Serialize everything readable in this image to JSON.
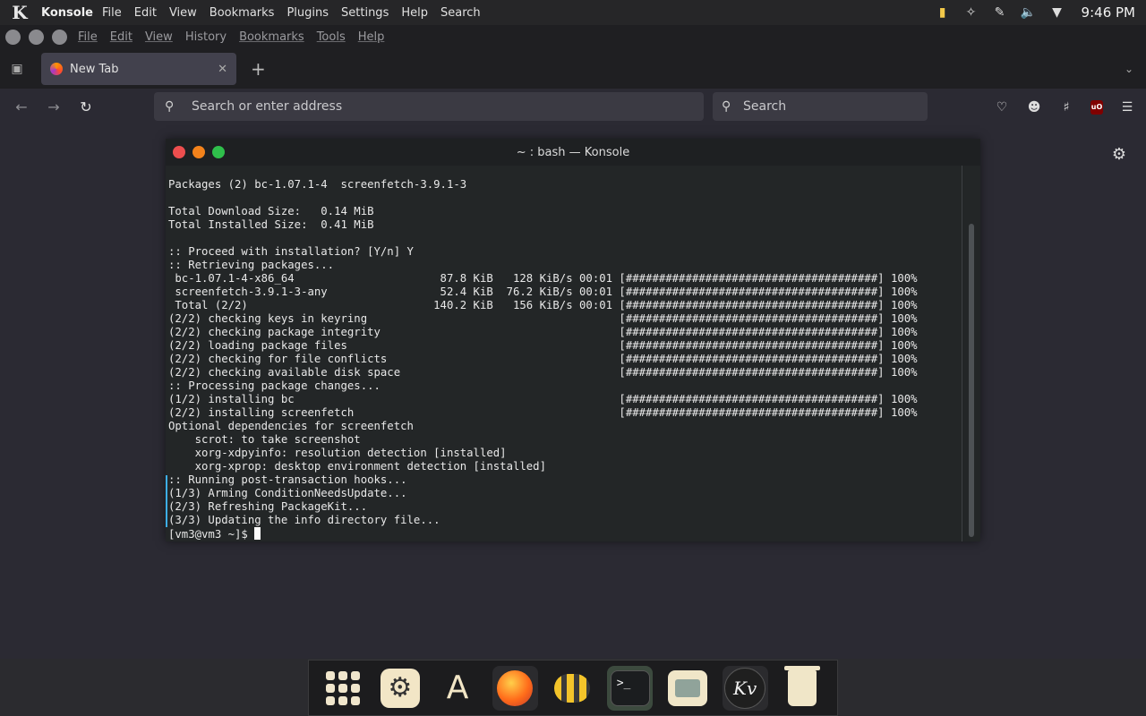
{
  "top_panel": {
    "app_name": "Konsole",
    "global_menu": [
      "File",
      "Edit",
      "View",
      "Bookmarks",
      "Plugins",
      "Settings",
      "Help",
      "Search"
    ],
    "clock": "9:46 PM",
    "tray_icons": [
      "package-updates-icon",
      "network-icon",
      "pen-icon",
      "volume-muted-icon",
      "chevron-down-icon"
    ]
  },
  "firefox": {
    "menubar": [
      "File",
      "Edit",
      "View",
      "History",
      "Bookmarks",
      "Tools",
      "Help"
    ],
    "tab": {
      "title": "New Tab"
    },
    "urlbar": {
      "placeholder": "Search or enter address"
    },
    "searchbar": {
      "placeholder": "Search"
    },
    "colors": {
      "toolbar": "#2b2a33",
      "tab_active": "#42414d",
      "field": "#3b3a43"
    }
  },
  "konsole": {
    "title": "~ : bash — Konsole",
    "lines": [
      "Packages (2) bc-1.07.1-4  screenfetch-3.9.1-3",
      "",
      "Total Download Size:   0.14 MiB",
      "Total Installed Size:  0.41 MiB",
      "",
      ":: Proceed with installation? [Y/n] Y",
      ":: Retrieving packages...",
      " bc-1.07.1-4-x86_64                      87.8 KiB   128 KiB/s 00:01 [######################################] 100%",
      " screenfetch-3.9.1-3-any                 52.4 KiB  76.2 KiB/s 00:01 [######################################] 100%",
      " Total (2/2)                            140.2 KiB   156 KiB/s 00:01 [######################################] 100%",
      "(2/2) checking keys in keyring                                      [######################################] 100%",
      "(2/2) checking package integrity                                    [######################################] 100%",
      "(2/2) loading package files                                         [######################################] 100%",
      "(2/2) checking for file conflicts                                   [######################################] 100%",
      "(2/2) checking available disk space                                 [######################################] 100%",
      ":: Processing package changes...",
      "(1/2) installing bc                                                 [######################################] 100%",
      "(2/2) installing screenfetch                                        [######################################] 100%",
      "Optional dependencies for screenfetch",
      "    scrot: to take screenshot",
      "    xorg-xdpyinfo: resolution detection [installed]",
      "    xorg-xprop: desktop environment detection [installed]",
      ":: Running post-transaction hooks...",
      "(1/3) Arming ConditionNeedsUpdate...",
      "(2/3) Refreshing PackageKit...",
      "(3/3) Updating the info directory file..."
    ],
    "prompt": "[vm3@vm3 ~]$ "
  },
  "dock": {
    "items": [
      "app-grid",
      "settings",
      "software-store",
      "firefox",
      "bee-app",
      "konsole",
      "file-manager",
      "kvantum",
      "trash"
    ]
  }
}
